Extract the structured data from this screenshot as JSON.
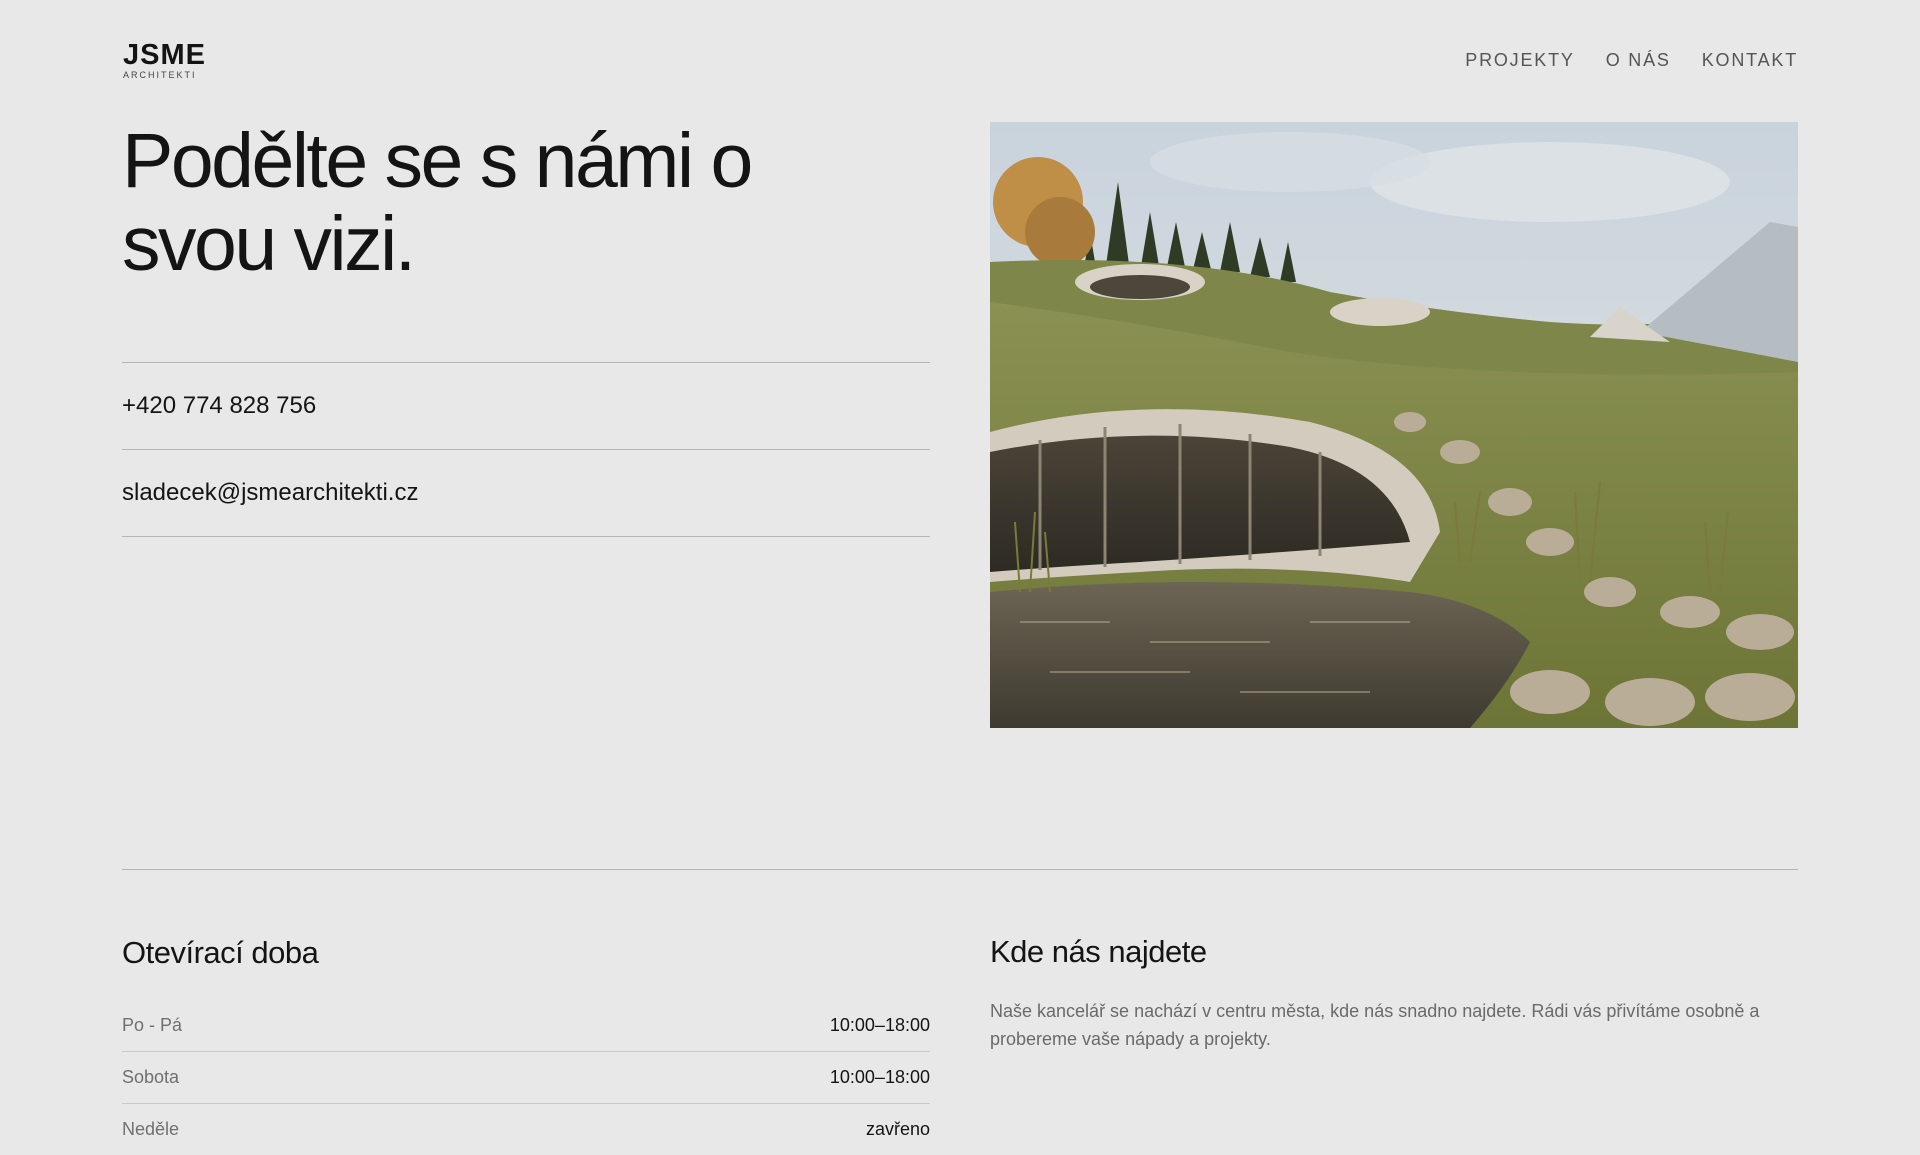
{
  "header": {
    "logo_main": "JSME",
    "logo_sub": "ARCHITEKTI",
    "nav": [
      {
        "label": "PROJEKTY"
      },
      {
        "label": "O NÁS"
      },
      {
        "label": "KONTAKT"
      }
    ]
  },
  "hero": {
    "title_line1": "Podělte se s námi o",
    "title_line2": "svou vizi.",
    "phone": "+420 774 828 756",
    "email": "sladecek@jsmearchitekti.cz"
  },
  "hours": {
    "title": "Otevírací doba",
    "rows": [
      {
        "day": "Po - Pá",
        "time": "10:00–18:00"
      },
      {
        "day": "Sobota",
        "time": "10:00–18:00"
      },
      {
        "day": "Neděle",
        "time": "zavřeno"
      }
    ]
  },
  "location": {
    "title": "Kde nás najdete",
    "text": "Naše kancelář se nachází v centru města, kde nás snadno najdete. Rádi vás přivítáme osobně a probereme vaše nápady a projekty."
  },
  "colors": {
    "background": "#e8e8e8",
    "text": "#141414",
    "muted": "#6a6a6a",
    "divider": "#b5b5b5"
  }
}
